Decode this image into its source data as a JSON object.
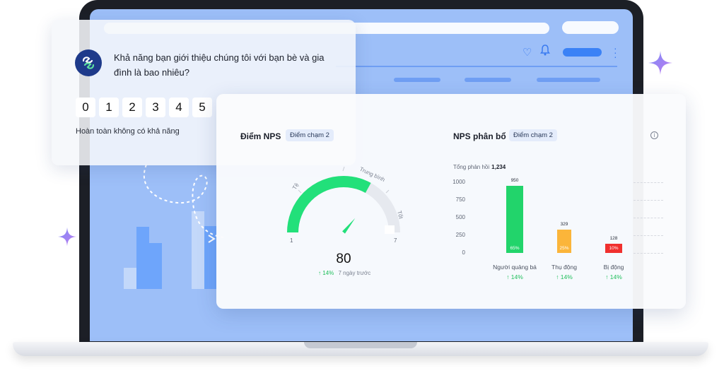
{
  "survey": {
    "question": "Khả năng bạn giới thiệu chúng tôi với bạn bè và gia đình là bao nhiêu?",
    "scale": [
      "0",
      "1",
      "2",
      "3",
      "4",
      "5"
    ],
    "low_label": "Hoàn toàn không có khả năng"
  },
  "nps": {
    "title": "Điểm NPS",
    "tag": "Điểm chạm 2",
    "gauge_labels": {
      "low": "Tệ",
      "mid": "Trung bình",
      "high": "Tốt",
      "min": "1",
      "max": "7"
    },
    "gauge_level": 0.66,
    "score": "80",
    "change": "↑ 14%",
    "change_period": "7 ngày trước"
  },
  "distribution": {
    "title": "NPS phân bổ",
    "tag": "Điểm chạm 2",
    "total_label": "Tổng phản hồi",
    "total_value": "1,234",
    "chart_data": {
      "type": "bar",
      "categories": [
        "Người quảng bá",
        "Thụ động",
        "Bị động"
      ],
      "values": [
        950,
        329,
        128
      ],
      "percent_labels": [
        "65%",
        "25%",
        "10%"
      ],
      "changes": [
        "↑ 14%",
        "↑ 14%",
        "↑ 14%"
      ],
      "yticks": [
        "1000",
        "750",
        "500",
        "250",
        "0"
      ],
      "ylim": [
        0,
        1000
      ],
      "colors": [
        "#22d46b",
        "#fbb53a",
        "#f0302e"
      ]
    }
  },
  "colors": {
    "screen": "#9dbff8",
    "accent": "#3b82f6",
    "gauge": "#22e07a"
  }
}
